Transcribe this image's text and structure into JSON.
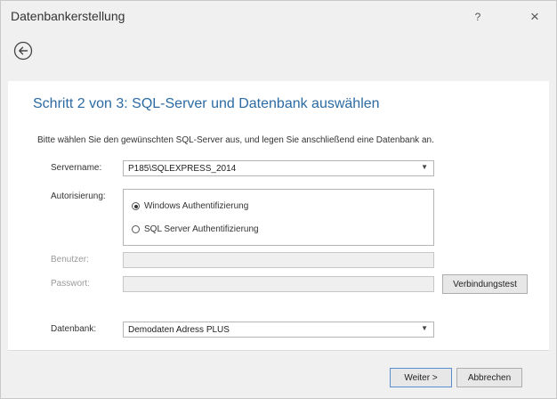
{
  "window": {
    "title": "Datenbankerstellung",
    "help_label": "?",
    "close_label": "×"
  },
  "page": {
    "heading": "Schritt 2 von 3: SQL-Server und Datenbank auswählen",
    "intro": "Bitte wählen Sie den gewünschten SQL-Server aus, und legen Sie anschließend eine Datenbank an."
  },
  "form": {
    "server_label": "Servername:",
    "server_value": "P185\\SQLEXPRESS_2014",
    "auth_label": "Autorisierung:",
    "auth_options": [
      {
        "label": "Windows Authentifizierung",
        "selected": true
      },
      {
        "label": "SQL Server Authentifizierung",
        "selected": false
      }
    ],
    "user_label": "Benutzer:",
    "user_value": "",
    "password_label": "Passwort:",
    "password_value": "",
    "test_button": "Verbindungstest",
    "db_label": "Datenbank:",
    "db_value": "Demodaten Adress PLUS"
  },
  "footer": {
    "next_button": "Weiter >",
    "cancel_button": "Abbrechen"
  },
  "colors": {
    "heading": "#2b6aa3",
    "window_bg": "#f0f0f0",
    "content_bg": "#ffffff"
  },
  "icons": {
    "back": "back-arrow-circle-icon",
    "dropdown": "chevron-down-icon",
    "close": "close-icon",
    "help": "help-icon"
  }
}
